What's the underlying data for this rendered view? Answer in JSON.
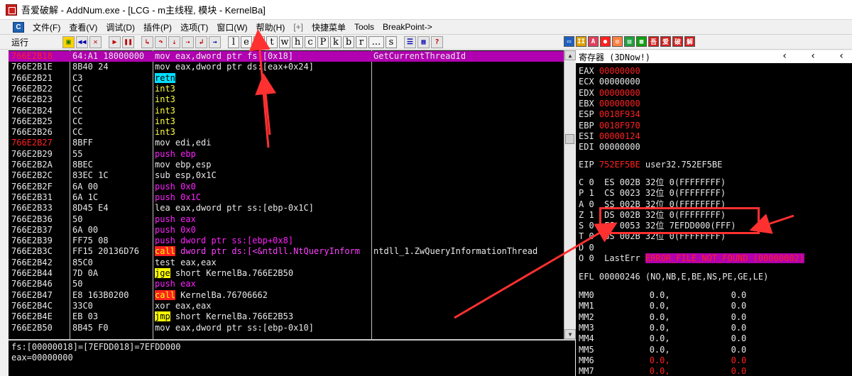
{
  "window": {
    "title": "吾爱破解 - AddNum.exe - [LCG - m主线程, 模块 - KernelBa]"
  },
  "menu": {
    "icon_label": "C",
    "items": [
      "文件(F)",
      "查看(V)",
      "调试(D)",
      "插件(P)",
      "选项(T)",
      "窗口(W)",
      "帮助(H)",
      "[+]",
      "快捷菜单",
      "Tools",
      "BreakPoint->"
    ]
  },
  "toolbar": {
    "status": "运行",
    "letters": [
      "l",
      "e",
      "m",
      "t",
      "w",
      "h",
      "c",
      "P",
      "k",
      "b",
      "r",
      "...",
      "s"
    ]
  },
  "disasm": {
    "rows": [
      {
        "addr": "766E2B18",
        "hex": "64:A1 18000000",
        "asm": "mov eax,dword ptr fs:[0x18]",
        "comment": "GetCurrentThreadId"
      },
      {
        "addr": "766E2B1E",
        "hex": "8B40 24",
        "asm": "mov eax,dword ptr ds:[eax+0x24]",
        "comment": ""
      },
      {
        "addr": "766E2B21",
        "hex": "C3",
        "asm": "retn",
        "comment": ""
      },
      {
        "addr": "766E2B22",
        "hex": "CC",
        "asm": "int3",
        "comment": ""
      },
      {
        "addr": "766E2B23",
        "hex": "CC",
        "asm": "int3",
        "comment": ""
      },
      {
        "addr": "766E2B24",
        "hex": "CC",
        "asm": "int3",
        "comment": ""
      },
      {
        "addr": "766E2B25",
        "hex": "CC",
        "asm": "int3",
        "comment": ""
      },
      {
        "addr": "766E2B26",
        "hex": "CC",
        "asm": "int3",
        "comment": ""
      },
      {
        "addr": "766E2B27",
        "hex": "8BFF",
        "asm": "mov edi,edi",
        "comment": ""
      },
      {
        "addr": "766E2B29",
        "hex": "55",
        "asm": "push ebp",
        "comment": ""
      },
      {
        "addr": "766E2B2A",
        "hex": "8BEC",
        "asm": "mov ebp,esp",
        "comment": ""
      },
      {
        "addr": "766E2B2C",
        "hex": "83EC 1C",
        "asm": "sub esp,0x1C",
        "comment": ""
      },
      {
        "addr": "766E2B2F",
        "hex": "6A 00",
        "asm": "push 0x0",
        "comment": ""
      },
      {
        "addr": "766E2B31",
        "hex": "6A 1C",
        "asm": "push 0x1C",
        "comment": ""
      },
      {
        "addr": "766E2B33",
        "hex": "8D45 E4",
        "asm": "lea eax,dword ptr ss:[ebp-0x1C]",
        "comment": ""
      },
      {
        "addr": "766E2B36",
        "hex": "50",
        "asm": "push eax",
        "comment": ""
      },
      {
        "addr": "766E2B37",
        "hex": "6A 00",
        "asm": "push 0x0",
        "comment": ""
      },
      {
        "addr": "766E2B39",
        "hex": "FF75 08",
        "asm": "push dword ptr ss:[ebp+0x8]",
        "comment": ""
      },
      {
        "addr": "766E2B3C",
        "hex": "FF15 20136D76",
        "asm": "call dword ptr ds:[<&ntdll.NtQueryInform",
        "comment": "ntdll_1.ZwQueryInformationThread"
      },
      {
        "addr": "766E2B42",
        "hex": "85C0",
        "asm": "test eax,eax",
        "comment": ""
      },
      {
        "addr": "766E2B44",
        "hex": "7D 0A",
        "asm": "jge short KernelBa.766E2B50",
        "comment": ""
      },
      {
        "addr": "766E2B46",
        "hex": "50",
        "asm": "push eax",
        "comment": ""
      },
      {
        "addr": "766E2B47",
        "hex": "E8 163B0200",
        "asm": "call KernelBa.76706662",
        "comment": ""
      },
      {
        "addr": "766E2B4C",
        "hex": "33C0",
        "asm": "xor eax,eax",
        "comment": ""
      },
      {
        "addr": "766E2B4E",
        "hex": "EB 03",
        "asm": "jmp short KernelBa.766E2B53",
        "comment": ""
      },
      {
        "addr": "766E2B50",
        "hex": "8B45 F0",
        "asm": "mov eax,dword ptr ss:[ebp-0x10]",
        "comment": ""
      }
    ]
  },
  "info": {
    "line1": "fs:[00000018]=[7EFDD018]=7EFDD000",
    "line2": "eax=00000000"
  },
  "registers": {
    "header": "寄存器 (3DNow!)",
    "gp": [
      {
        "name": "EAX",
        "value": "00000000"
      },
      {
        "name": "ECX",
        "value": "00000000"
      },
      {
        "name": "EDX",
        "value": "00000000"
      },
      {
        "name": "EBX",
        "value": "00000000"
      },
      {
        "name": "ESP",
        "value": "0018F934"
      },
      {
        "name": "EBP",
        "value": "0018F970"
      },
      {
        "name": "ESI",
        "value": "00000124"
      },
      {
        "name": "EDI",
        "value": "00000000"
      }
    ],
    "eip": {
      "name": "EIP",
      "value": "752EF5BE",
      "symbol": "user32.752EF5BE"
    },
    "segs": [
      "C 0  ES 002B 32位 0(FFFFFFFF)",
      "P 1  CS 0023 32位 0(FFFFFFFF)",
      "A 0  SS 002B 32位 0(FFFFFFFF)",
      "Z 1  DS 002B 32位 0(FFFFFFFF)",
      "S 0  FS 0053 32位 7EFDD000(FFF)",
      "T 0  GS 002B 32位 0(FFFFFFFF)",
      "D 0"
    ],
    "lasterr_prefix": "O 0  LastErr",
    "lasterr_value": "ERROR_FILE_NOT_FOUND (00000002)",
    "efl": "EFL 00000246 (NO,NB,E,BE,NS,PE,GE,LE)",
    "mm": [
      {
        "name": "MM0",
        "a": "0.0,",
        "b": "0.0"
      },
      {
        "name": "MM1",
        "a": "0.0,",
        "b": "0.0"
      },
      {
        "name": "MM2",
        "a": "0.0,",
        "b": "0.0"
      },
      {
        "name": "MM3",
        "a": "0.0,",
        "b": "0.0"
      },
      {
        "name": "MM4",
        "a": "0.0,",
        "b": "0.0"
      },
      {
        "name": "MM5",
        "a": "0.0,",
        "b": "0.0"
      },
      {
        "name": "MM6",
        "a": "0.0,",
        "b": "0.0"
      },
      {
        "name": "MM7",
        "a": "0.0,",
        "b": "0.0"
      }
    ]
  },
  "colors": {
    "selected_row": "#b000b0",
    "red_text": "#ff2020",
    "annotation": "#ff3030"
  }
}
